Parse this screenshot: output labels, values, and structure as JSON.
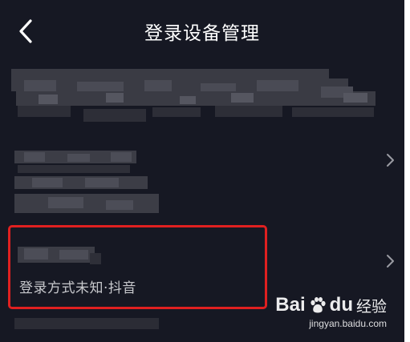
{
  "header": {
    "title": "登录设备管理"
  },
  "devices": [
    {
      "label": "device-1",
      "login_method": ""
    },
    {
      "label": "device-2",
      "login_method": ""
    },
    {
      "label": "device-3",
      "login_method": "登录方式未知·抖音"
    }
  ],
  "watermark": {
    "brand": "Bai",
    "brand_suffix": "du",
    "cn": "经验",
    "url": "jingyan.baidu.com"
  },
  "colors": {
    "background": "#161823",
    "highlight": "#e02020",
    "text_primary": "#ffffff",
    "text_secondary": "#c7c8cc"
  },
  "icons": {
    "back": "chevron-left-icon",
    "row_arrow": "chevron-right-icon",
    "watermark_logo": "baidu-paw-icon"
  }
}
